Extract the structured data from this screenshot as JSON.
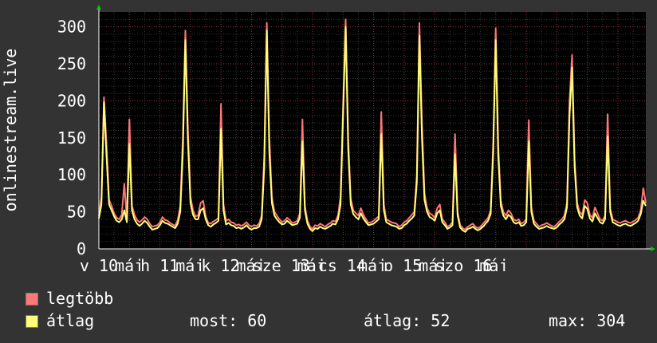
{
  "chart_data": {
    "type": "area",
    "ylabel": "onlinestream.live",
    "ylim": [
      0,
      320
    ],
    "y_ticks": [
      "0",
      "50",
      "100",
      "150",
      "200",
      "250",
      "300"
    ],
    "x_tick_labels": [
      "v 10",
      "máj",
      "h 11",
      "máj",
      "k 12",
      "máj",
      "sze 13",
      "máj",
      "cs 14",
      "máj",
      "p 15",
      "máj",
      "szo 16",
      "máj"
    ],
    "grid": true,
    "points_per_day": 24,
    "series": [
      {
        "name": "legtöbb",
        "color": "#ff7777",
        "values": [
          44,
          70,
          205,
          140,
          66,
          58,
          48,
          42,
          40,
          46,
          88,
          40,
          175,
          58,
          46,
          39,
          36,
          39,
          43,
          40,
          34,
          30,
          31,
          32,
          36,
          43,
          39,
          38,
          35,
          33,
          31,
          39,
          58,
          150,
          295,
          160,
          70,
          52,
          44,
          45,
          62,
          65,
          44,
          35,
          34,
          37,
          39,
          42,
          196,
          60,
          38,
          40,
          36,
          35,
          32,
          33,
          31,
          33,
          36,
          32,
          30,
          32,
          31,
          34,
          45,
          125,
          305,
          150,
          70,
          50,
          45,
          40,
          36,
          38,
          42,
          39,
          35,
          36,
          38,
          48,
          175,
          58,
          38,
          30,
          27,
          32,
          31,
          34,
          32,
          30,
          33,
          35,
          38,
          37,
          45,
          70,
          195,
          310,
          150,
          68,
          52,
          48,
          45,
          55,
          46,
          40,
          35,
          36,
          38,
          41,
          44,
          185,
          60,
          40,
          38,
          36,
          35,
          34,
          30,
          32,
          36,
          38,
          42,
          46,
          50,
          100,
          305,
          170,
          75,
          55,
          48,
          46,
          42,
          55,
          60,
          40,
          36,
          30,
          32,
          36,
          155,
          50,
          32,
          28,
          26,
          30,
          32,
          34,
          30,
          28,
          30,
          34,
          38,
          42,
          52,
          145,
          298,
          140,
          65,
          50,
          45,
          52,
          48,
          40,
          38,
          40,
          34,
          36,
          40,
          174,
          56,
          38,
          34,
          30,
          32,
          33,
          35,
          33,
          31,
          30,
          33,
          37,
          40,
          45,
          62,
          200,
          262,
          120,
          62,
          50,
          46,
          66,
          62,
          46,
          42,
          56,
          48,
          40,
          38,
          45,
          182,
          55,
          40,
          38,
          36,
          35,
          37,
          38,
          36,
          35,
          37,
          39,
          42,
          52,
          82,
          62
        ]
      },
      {
        "name": "átlag",
        "color": "#ffff77",
        "values": [
          41,
          60,
          198,
          125,
          60,
          52,
          44,
          38,
          36,
          40,
          52,
          36,
          142,
          52,
          40,
          34,
          31,
          34,
          38,
          35,
          30,
          26,
          27,
          28,
          32,
          38,
          35,
          34,
          32,
          30,
          28,
          34,
          50,
          130,
          282,
          145,
          62,
          46,
          40,
          40,
          52,
          55,
          40,
          32,
          30,
          33,
          35,
          38,
          162,
          52,
          33,
          35,
          32,
          31,
          28,
          29,
          27,
          29,
          32,
          28,
          26,
          28,
          28,
          30,
          40,
          110,
          295,
          130,
          62,
          45,
          40,
          36,
          33,
          34,
          38,
          35,
          32,
          33,
          34,
          42,
          145,
          52,
          34,
          27,
          24,
          28,
          27,
          30,
          28,
          27,
          29,
          31,
          34,
          33,
          40,
          60,
          180,
          300,
          135,
          60,
          47,
          43,
          40,
          48,
          41,
          36,
          32,
          33,
          34,
          37,
          40,
          155,
          52,
          36,
          34,
          32,
          31,
          30,
          27,
          28,
          32,
          34,
          38,
          41,
          45,
          90,
          288,
          150,
          66,
          50,
          43,
          41,
          38,
          48,
          52,
          36,
          32,
          27,
          29,
          32,
          128,
          45,
          29,
          25,
          23,
          27,
          28,
          30,
          27,
          25,
          27,
          30,
          34,
          38,
          47,
          130,
          282,
          125,
          58,
          45,
          40,
          46,
          43,
          36,
          34,
          36,
          31,
          32,
          36,
          145,
          50,
          34,
          30,
          27,
          28,
          29,
          31,
          29,
          28,
          27,
          29,
          33,
          36,
          40,
          56,
          180,
          245,
          110,
          56,
          45,
          41,
          58,
          54,
          41,
          37,
          48,
          42,
          36,
          34,
          40,
          152,
          50,
          36,
          34,
          32,
          31,
          33,
          34,
          32,
          31,
          33,
          35,
          38,
          47,
          65,
          58
        ]
      }
    ]
  },
  "legend": {
    "max_label": "legtöbb",
    "avg_label": "átlag",
    "current": "most: 60",
    "average": "átlag: 52",
    "maximum": "max: 304"
  }
}
